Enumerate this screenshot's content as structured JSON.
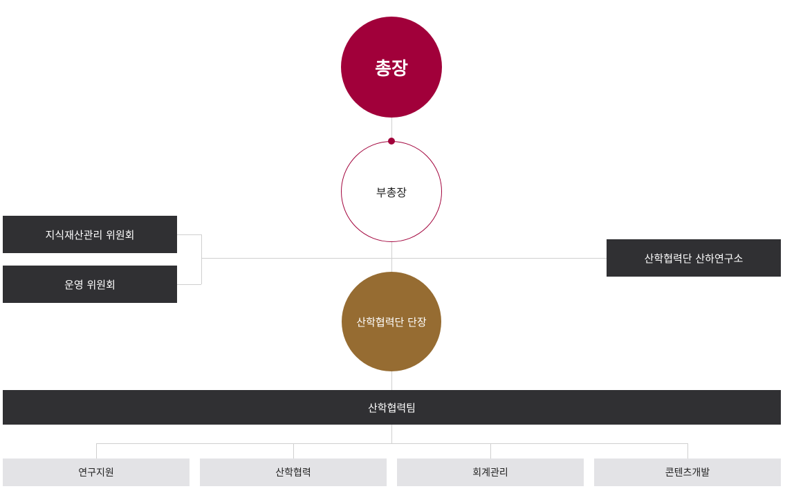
{
  "org_chart": {
    "president": "총장",
    "vice_president": "부총장",
    "committees": [
      "지식재산관리 위원회",
      "운영 위원회"
    ],
    "institute": "산학협력단 산하연구소",
    "foundation_head": "산학협력단 단장",
    "team": "산학협력팀",
    "departments": [
      "연구지원",
      "산학협력",
      "회계관리",
      "콘텐츠개발"
    ]
  },
  "colors": {
    "president": "#a1003a",
    "head": "#966c32",
    "dark_box": "#303033",
    "light_box": "#e3e3e6"
  }
}
